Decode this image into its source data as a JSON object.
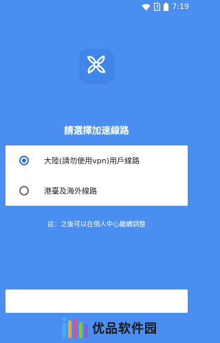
{
  "status_bar": {
    "time": "7:19",
    "icons": [
      "wifi-icon",
      "sim-alert-icon",
      "battery-icon"
    ]
  },
  "logo": {
    "icon": "fan-logo-icon",
    "colors": {
      "tile": "#3f86ea",
      "mark": "#ffffff"
    }
  },
  "title": "請選擇加速線路",
  "options": [
    {
      "label": "大陸(請勿使用vpn)用戶線路",
      "selected": true
    },
    {
      "label": "港臺及海外線路",
      "selected": false
    }
  ],
  "note": "註：之後可以在個人中心繼續調整",
  "watermark": {
    "text": "优品软件园"
  },
  "colors": {
    "background": "#4a8ef2",
    "radio_selected": "#2f6fdc",
    "card": "#ffffff"
  }
}
